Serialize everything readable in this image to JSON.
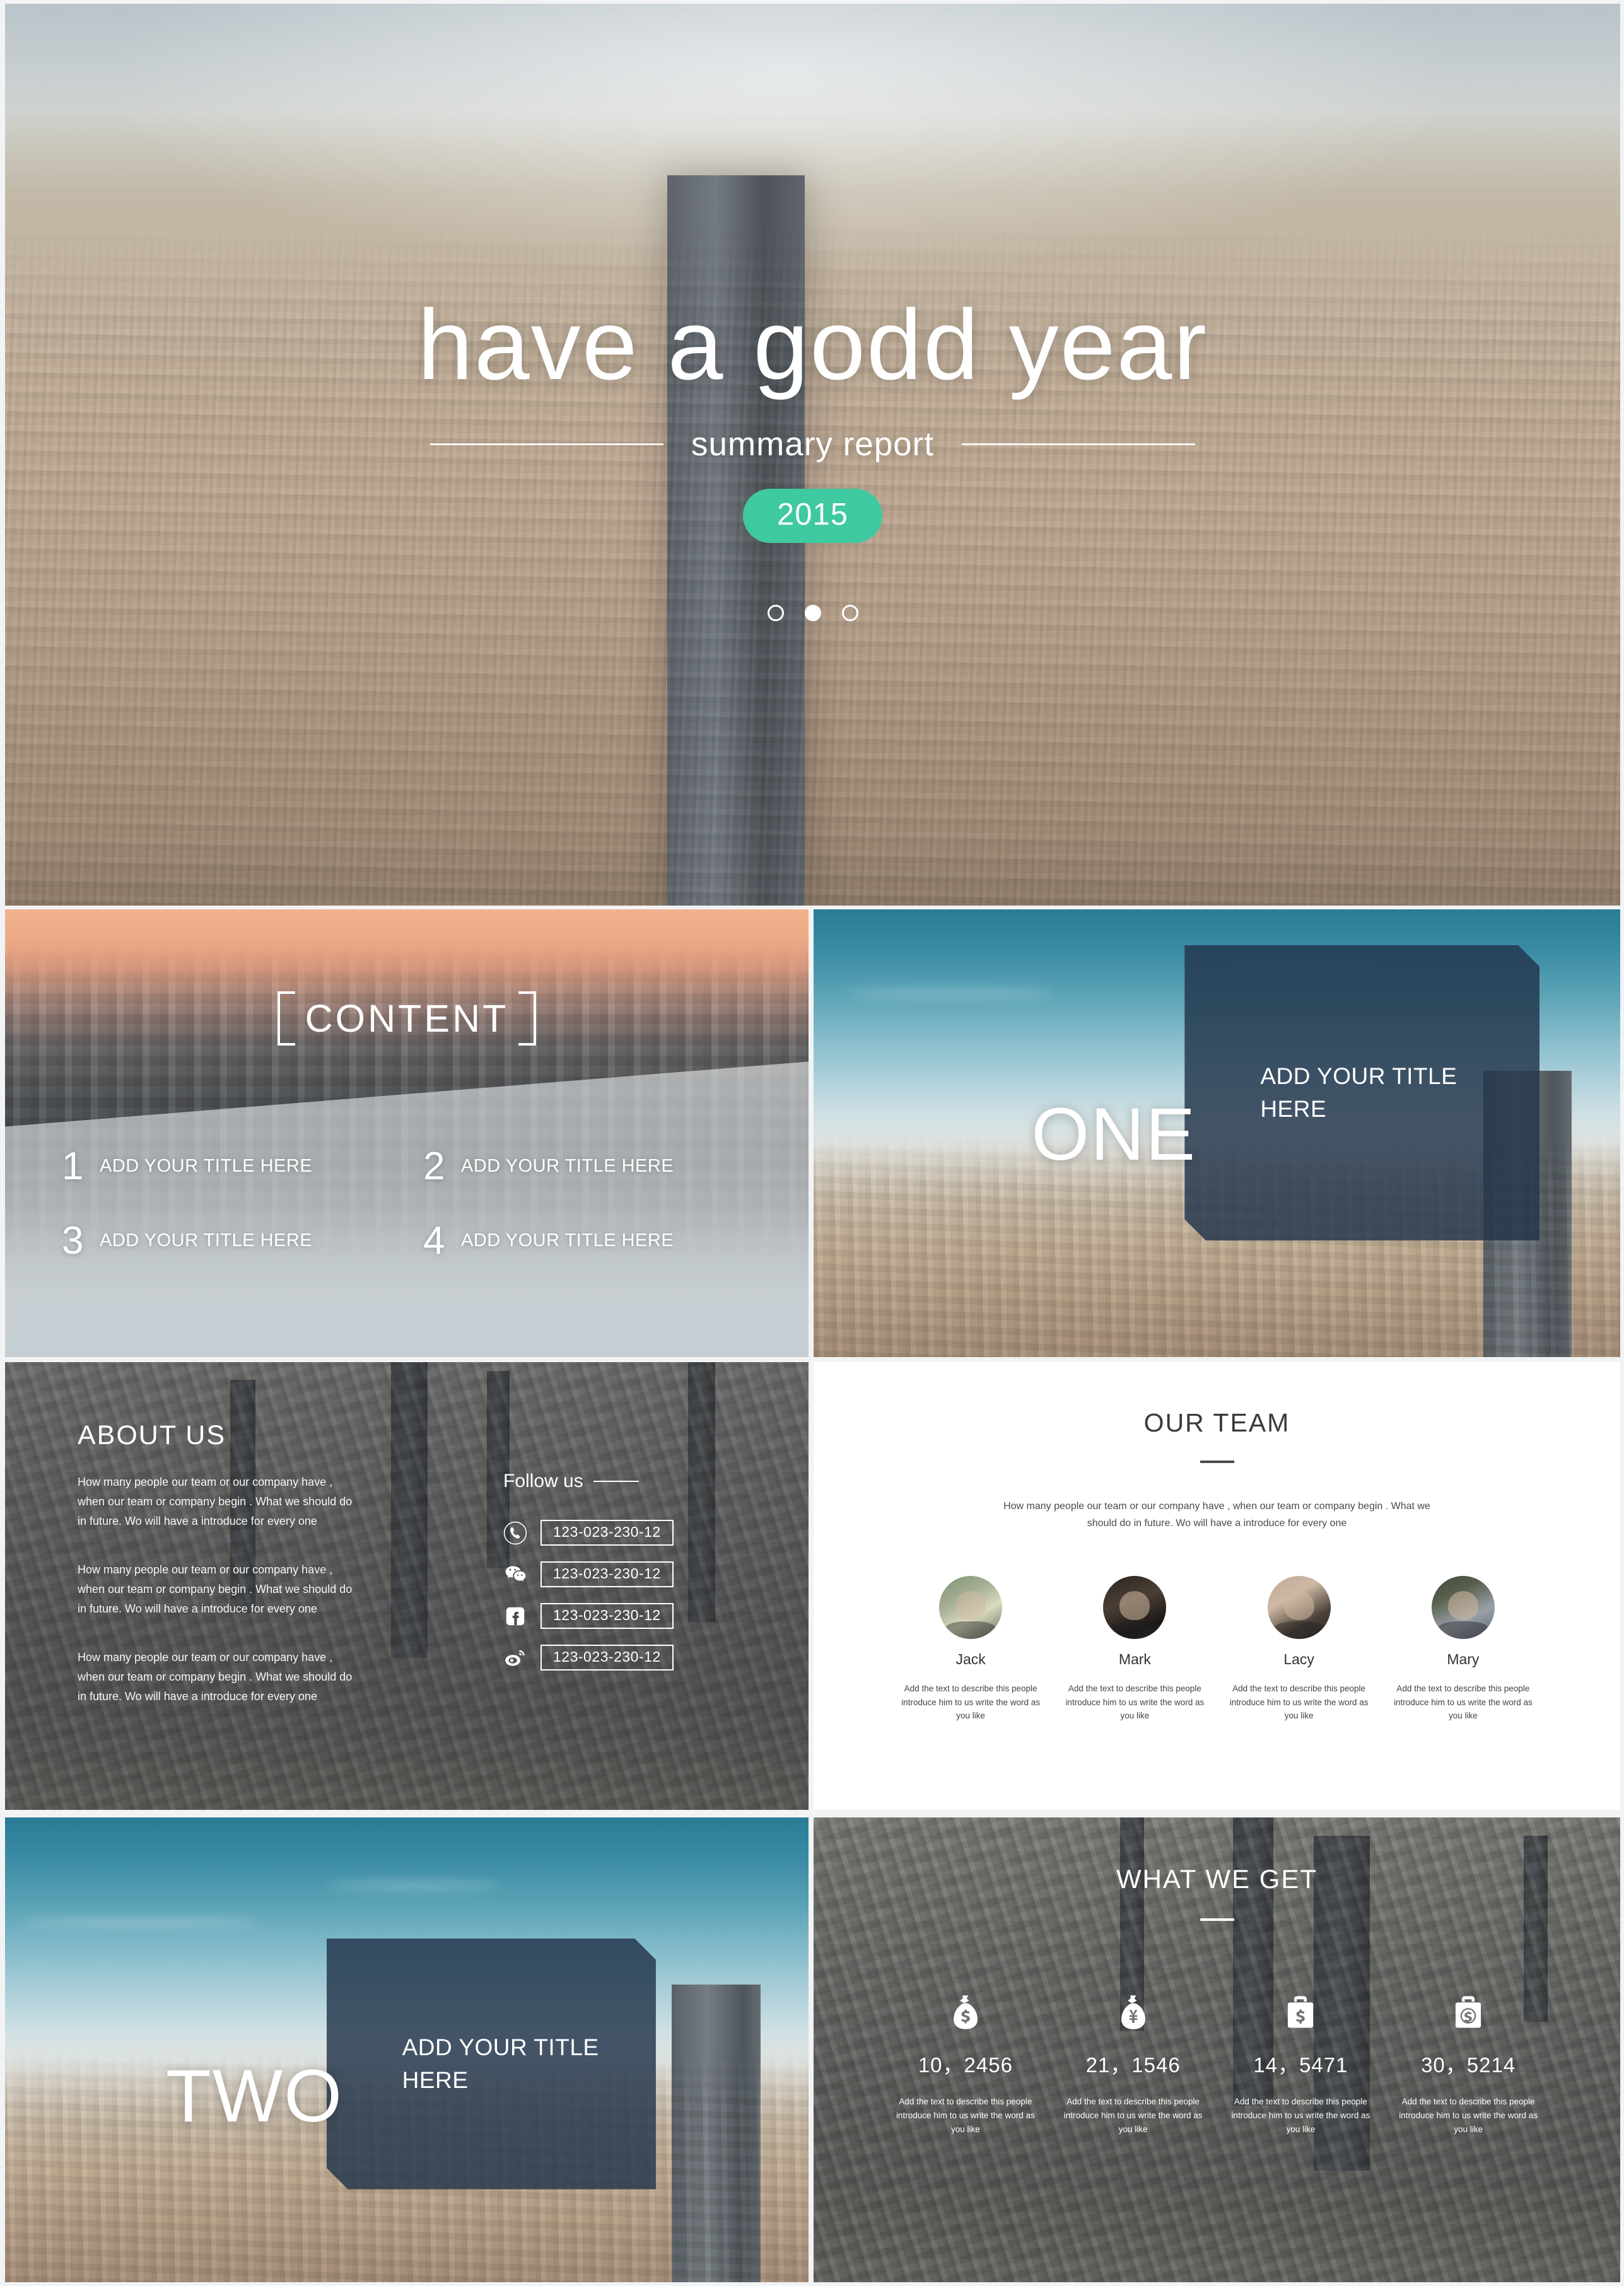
{
  "title_slide": {
    "heading": "have a godd year",
    "subheading": "summary report",
    "year_badge": "2015",
    "accent_color": "#3fc9a0",
    "carousel": {
      "total": 3,
      "active_index": 1
    }
  },
  "content_slide": {
    "title": "CONTENT",
    "items": [
      {
        "number": "1",
        "label": "ADD YOUR TITLE HERE"
      },
      {
        "number": "2",
        "label": "ADD YOUR TITLE HERE"
      },
      {
        "number": "3",
        "label": "ADD YOUR TITLE HERE"
      },
      {
        "number": "4",
        "label": "ADD YOUR TITLE HERE"
      }
    ]
  },
  "section_one": {
    "number": "ONE",
    "title": "ADD YOUR TITLE HERE",
    "box_color": "#22344a"
  },
  "section_two": {
    "number": "TWO",
    "title": "ADD YOUR TITLE HERE",
    "box_color": "#22344a"
  },
  "about_slide": {
    "title": "ABOUT US",
    "paragraphs": [
      "How many people our team or our company have , when our team or company begin . What we should do in future. Wo will have a introduce for every one",
      "How many people our team or our company have , when our team or company begin . What we should do in future. Wo will have a introduce for every one",
      "How many people our team or our company have , when our team or company begin . What we should do in future. Wo will have a introduce for every one"
    ],
    "follow_label": "Follow us",
    "contacts": [
      {
        "icon": "phone-icon",
        "value": "123-023-230-12"
      },
      {
        "icon": "wechat-icon",
        "value": "123-023-230-12"
      },
      {
        "icon": "facebook-icon",
        "value": "123-023-230-12"
      },
      {
        "icon": "weibo-icon",
        "value": "123-023-230-12"
      }
    ]
  },
  "team_slide": {
    "title": "OUR TEAM",
    "intro": "How many people our team or our company have , when our team or company begin . What we should do in future. Wo will have a introduce for every one",
    "members": [
      {
        "name": "Jack",
        "desc": "Add the text to describe this people introduce him to us write the word as you like"
      },
      {
        "name": "Mark",
        "desc": "Add the text to describe this people introduce him to us write the word as you like"
      },
      {
        "name": "Lacy",
        "desc": "Add the text to describe this people introduce him to us write the word as you like"
      },
      {
        "name": "Mary",
        "desc": "Add the text to describe this people introduce him to us write the word as you like"
      }
    ]
  },
  "get_slide": {
    "title": "WHAT WE GET",
    "stats": [
      {
        "icon": "money-bag-dollar-icon",
        "value": "10，2456",
        "desc": "Add the text to describe this people introduce him to us write the word as you like"
      },
      {
        "icon": "money-bag-yen-icon",
        "value": "21，1546",
        "desc": "Add the text to describe this people introduce him to us write the word as you like"
      },
      {
        "icon": "briefcase-dollar-icon",
        "value": "14，5471",
        "desc": "Add the text to describe this people introduce him to us write the word as you like"
      },
      {
        "icon": "briefcase-dollar-round-icon",
        "value": "30，5214",
        "desc": "Add the text to describe this people introduce him to us write the word as you like"
      }
    ]
  }
}
